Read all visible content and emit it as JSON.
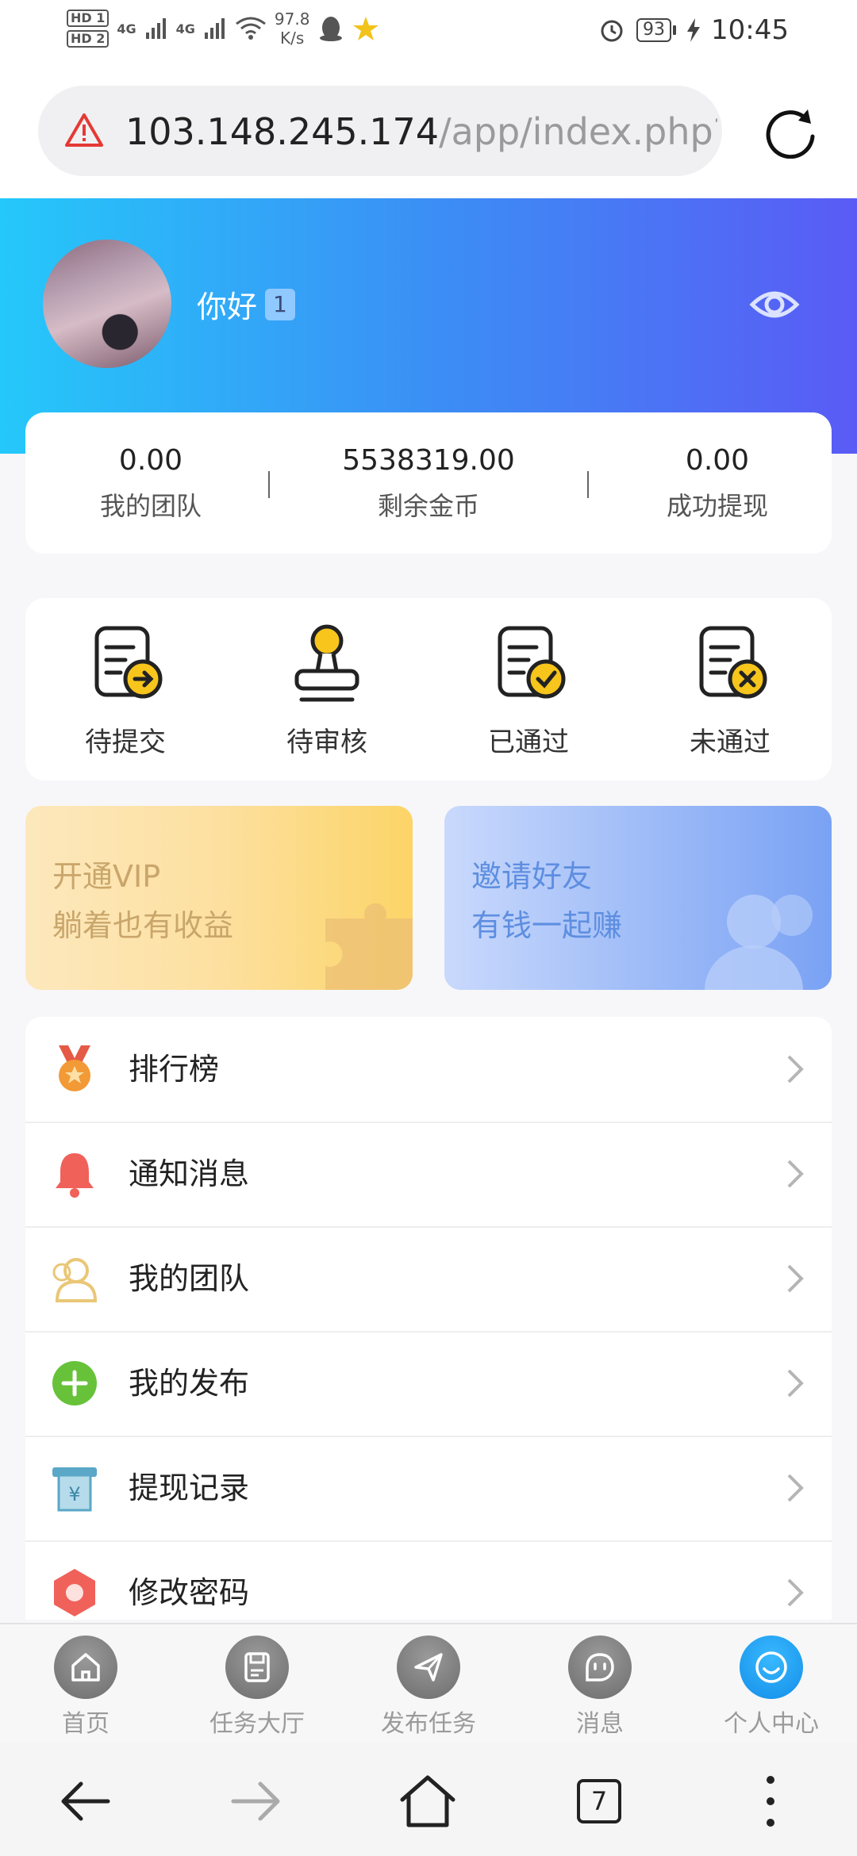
{
  "status_bar": {
    "sim1": "HD 1",
    "sim2": "HD 2",
    "net1": "4G",
    "net2": "4G",
    "speed_value": "97.8",
    "speed_unit": "K/s",
    "battery": "93",
    "time": "10:45"
  },
  "browser": {
    "url_host": "103.148.245.174",
    "url_path": "/app/index.php?i=",
    "icons": {
      "security": "warning-icon",
      "reload": "reload-icon"
    }
  },
  "profile": {
    "greeting": "你好",
    "level": "1",
    "icons": {
      "avatar": "avatar",
      "visibility": "eye-icon"
    }
  },
  "stats": [
    {
      "value": "0.00",
      "label": "我的团队"
    },
    {
      "value": "5538319.00",
      "label": "剩余金币"
    },
    {
      "value": "0.00",
      "label": "成功提现"
    }
  ],
  "task_status": [
    {
      "label": "待提交",
      "icon": "pending-submit-icon"
    },
    {
      "label": "待审核",
      "icon": "pending-review-stamp-icon"
    },
    {
      "label": "已通过",
      "icon": "approved-icon"
    },
    {
      "label": "未通过",
      "icon": "rejected-icon"
    }
  ],
  "promos": {
    "vip": {
      "line1": "开通VIP",
      "line2": "躺着也有收益",
      "icon": "puzzle-icon"
    },
    "invite": {
      "line1": "邀请好友",
      "line2": "有钱一起赚",
      "icon": "people-icon"
    }
  },
  "menu": [
    {
      "label": "排行榜",
      "icon": "medal-icon"
    },
    {
      "label": "通知消息",
      "icon": "bell-icon"
    },
    {
      "label": "我的团队",
      "icon": "team-icon"
    },
    {
      "label": "我的发布",
      "icon": "add-circle-icon"
    },
    {
      "label": "提现记录",
      "icon": "withdraw-box-icon"
    },
    {
      "label": "修改密码",
      "icon": "password-hexagon-icon"
    }
  ],
  "tabbar": [
    {
      "label": "首页",
      "icon": "home-icon",
      "active": false
    },
    {
      "label": "任务大厅",
      "icon": "task-hall-icon",
      "active": false
    },
    {
      "label": "发布任务",
      "icon": "send-icon",
      "active": false
    },
    {
      "label": "消息",
      "icon": "message-icon",
      "active": false
    },
    {
      "label": "个人中心",
      "icon": "profile-icon",
      "active": true
    }
  ],
  "colors": {
    "header_start": "#25c8fa",
    "header_end": "#5a5bf5",
    "active_tab": "#1a96ee",
    "warning": "#e53935",
    "accent_yellow": "#f7c51b"
  },
  "system_nav": {
    "open_tabs": "7"
  }
}
